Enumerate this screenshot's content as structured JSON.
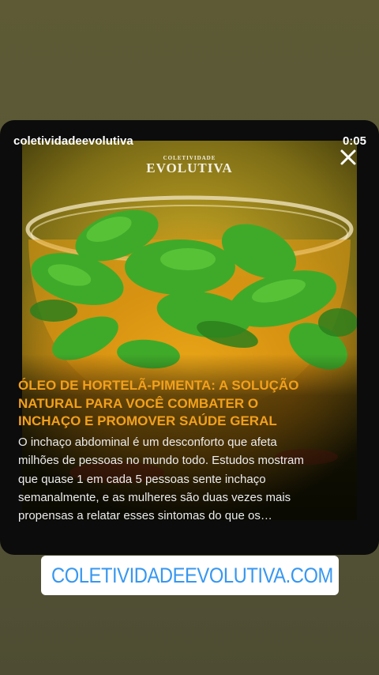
{
  "story": {
    "username": "coletividadeevolutiva",
    "timer": "0:05"
  },
  "post": {
    "logo_top": "COLETIVIDADE",
    "logo_main": "EVOLUTIVA",
    "headline": "ÓLEO DE HORTELÃ-PIMENTA: A SOLUÇÃO NATURAL PARA VOCÊ COMBATER O INCHAÇO E PROMOVER SAÚDE GERAL",
    "body": "O inchaço abdominal é um desconforto que afeta milhões de pessoas no mundo todo. Estudos mostram que quase 1 em cada 5 pessoas sente inchaço semanalmente, e as mulheres são duas vezes mais propensas a relatar esses sintomas do que os…"
  },
  "link_sticker": {
    "label": "COLETIVIDADEEVOLUTIVA.COM",
    "icon": "link-icon"
  },
  "colors": {
    "headline": "#f2a01c",
    "link": "#3797f0",
    "background": "#595737"
  }
}
